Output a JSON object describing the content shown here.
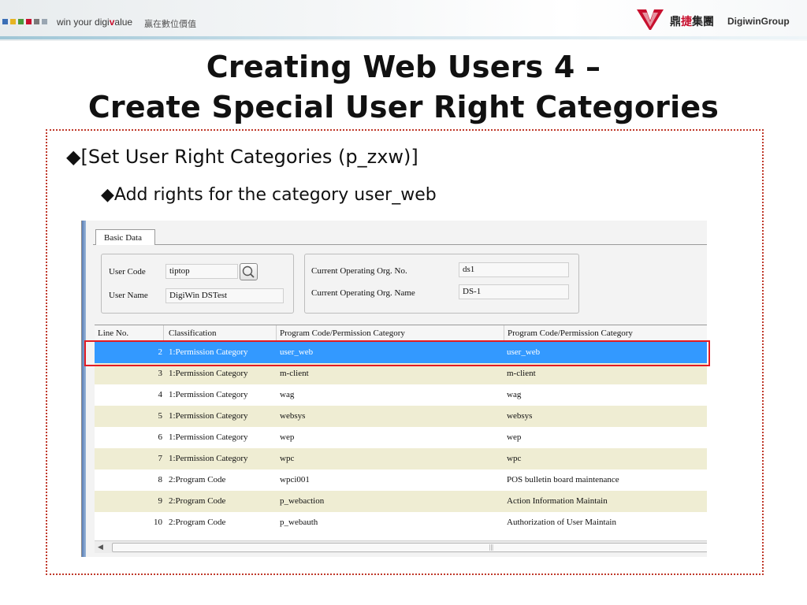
{
  "header": {
    "tagline": "win your digi",
    "tagline_mark": "v",
    "tagline_end": "alue",
    "tagline_cn": "贏在數位價值",
    "brand_cn_a": "鼎",
    "brand_cn_b": "捷",
    "brand_cn_c": "集團",
    "brand_en": "DigiwinGroup",
    "square_colors": [
      "#3b6fb6",
      "#e6b422",
      "#4a9a3a",
      "#c8102e",
      "#7a7a7a",
      "#9aa6b2"
    ]
  },
  "title": {
    "line1": "Creating Web Users 4 –",
    "line2": "Create Special User Right Categories"
  },
  "bullets": {
    "level1": "◆[Set User Right Categories (p_zxw)]",
    "level2": "◆Add rights for the category user_web"
  },
  "app": {
    "tab_label": "Basic Data",
    "user_code_label": "User Code",
    "user_code_value": "tiptop",
    "user_name_label": "User Name",
    "user_name_value": "DigiWin DSTest",
    "org_no_label": "Current Operating Org. No.",
    "org_no_value": "ds1",
    "org_name_label": "Current Operating Org. Name",
    "org_name_value": "DS-1",
    "grid": {
      "columns": [
        "Line No.",
        "Classification",
        "Program Code/Permission Category",
        "Program Code/Permission Category"
      ],
      "rows": [
        {
          "line": "2",
          "cls": "1:Permission Category",
          "code": "user_web",
          "code2": "user_web"
        },
        {
          "line": "3",
          "cls": "1:Permission Category",
          "code": "m-client",
          "code2": "m-client"
        },
        {
          "line": "4",
          "cls": "1:Permission Category",
          "code": "wag",
          "code2": "wag"
        },
        {
          "line": "5",
          "cls": "1:Permission Category",
          "code": "websys",
          "code2": "websys"
        },
        {
          "line": "6",
          "cls": "1:Permission Category",
          "code": "wep",
          "code2": "wep"
        },
        {
          "line": "7",
          "cls": "1:Permission Category",
          "code": "wpc",
          "code2": "wpc"
        },
        {
          "line": "8",
          "cls": "2:Program Code",
          "code": "wpci001",
          "code2": "POS bulletin board maintenance"
        },
        {
          "line": "9",
          "cls": "2:Program Code",
          "code": "p_webaction",
          "code2": "Action Information Maintain"
        },
        {
          "line": "10",
          "cls": "2:Program Code",
          "code": "p_webauth",
          "code2": "Authorization of User Maintain"
        }
      ]
    },
    "scroll_left_glyph": "◀",
    "scroll_grip": "|||"
  }
}
